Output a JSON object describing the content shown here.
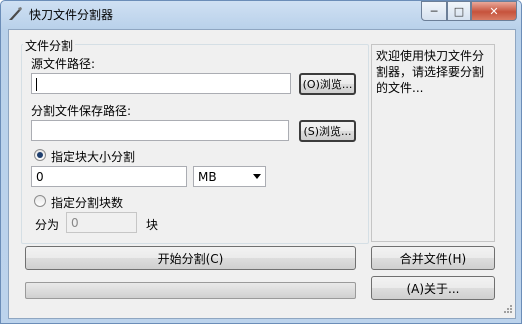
{
  "window": {
    "title": "快刀文件分割器",
    "close_glyph": "✕",
    "min_glyph": "─",
    "max_glyph": "□"
  },
  "group": {
    "title": "文件分割"
  },
  "source": {
    "label": "源文件路径:",
    "value": "",
    "browse_label": "(O)浏览..."
  },
  "save": {
    "label": "分割文件保存路径:",
    "value": "",
    "browse_label": "(S)浏览..."
  },
  "mode_size": {
    "label": "指定块大小分割",
    "checked": true,
    "value": "0",
    "unit": "MB"
  },
  "mode_count": {
    "label": "指定分割块数",
    "checked": false,
    "prefix": "分为",
    "value": "0",
    "suffix": "块"
  },
  "message": "欢迎使用快刀文件分割器，请选择要分割的文件...",
  "buttons": {
    "split": "开始分割(C)",
    "merge": "合并文件(H)",
    "about": "(A)关于..."
  },
  "progress": {
    "value": 0
  }
}
